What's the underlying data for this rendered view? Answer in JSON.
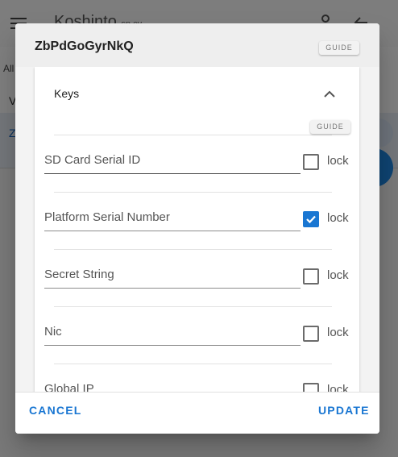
{
  "background": {
    "app_title": "Koshinto",
    "app_subtitle": "sp.cy",
    "toolbar_text": "All",
    "row1_text": "V",
    "row2_text": "Z"
  },
  "dialog": {
    "title": "ZbPdGoGyrNkQ",
    "guide_label": "GUIDE",
    "panel": {
      "title": "Keys",
      "guide_label": "GUIDE",
      "fields": [
        {
          "label": "SD Card Serial ID",
          "locked": false,
          "lock_label": "lock"
        },
        {
          "label": "Platform Serial Number",
          "locked": true,
          "lock_label": "lock"
        },
        {
          "label": "Secret String",
          "locked": false,
          "lock_label": "lock"
        },
        {
          "label": "Nic",
          "locked": false,
          "lock_label": "lock"
        },
        {
          "label": "Global IP",
          "locked": false,
          "lock_label": "lock"
        }
      ]
    },
    "actions": {
      "cancel_label": "CANCEL",
      "update_label": "UPDATE"
    }
  },
  "colors": {
    "accent": "#1976d2",
    "header_bg": "#eeeeee"
  },
  "icons": [
    "menu-icon",
    "person-icon",
    "back-arrow-icon",
    "chevron-up-icon",
    "checkmark-icon"
  ]
}
